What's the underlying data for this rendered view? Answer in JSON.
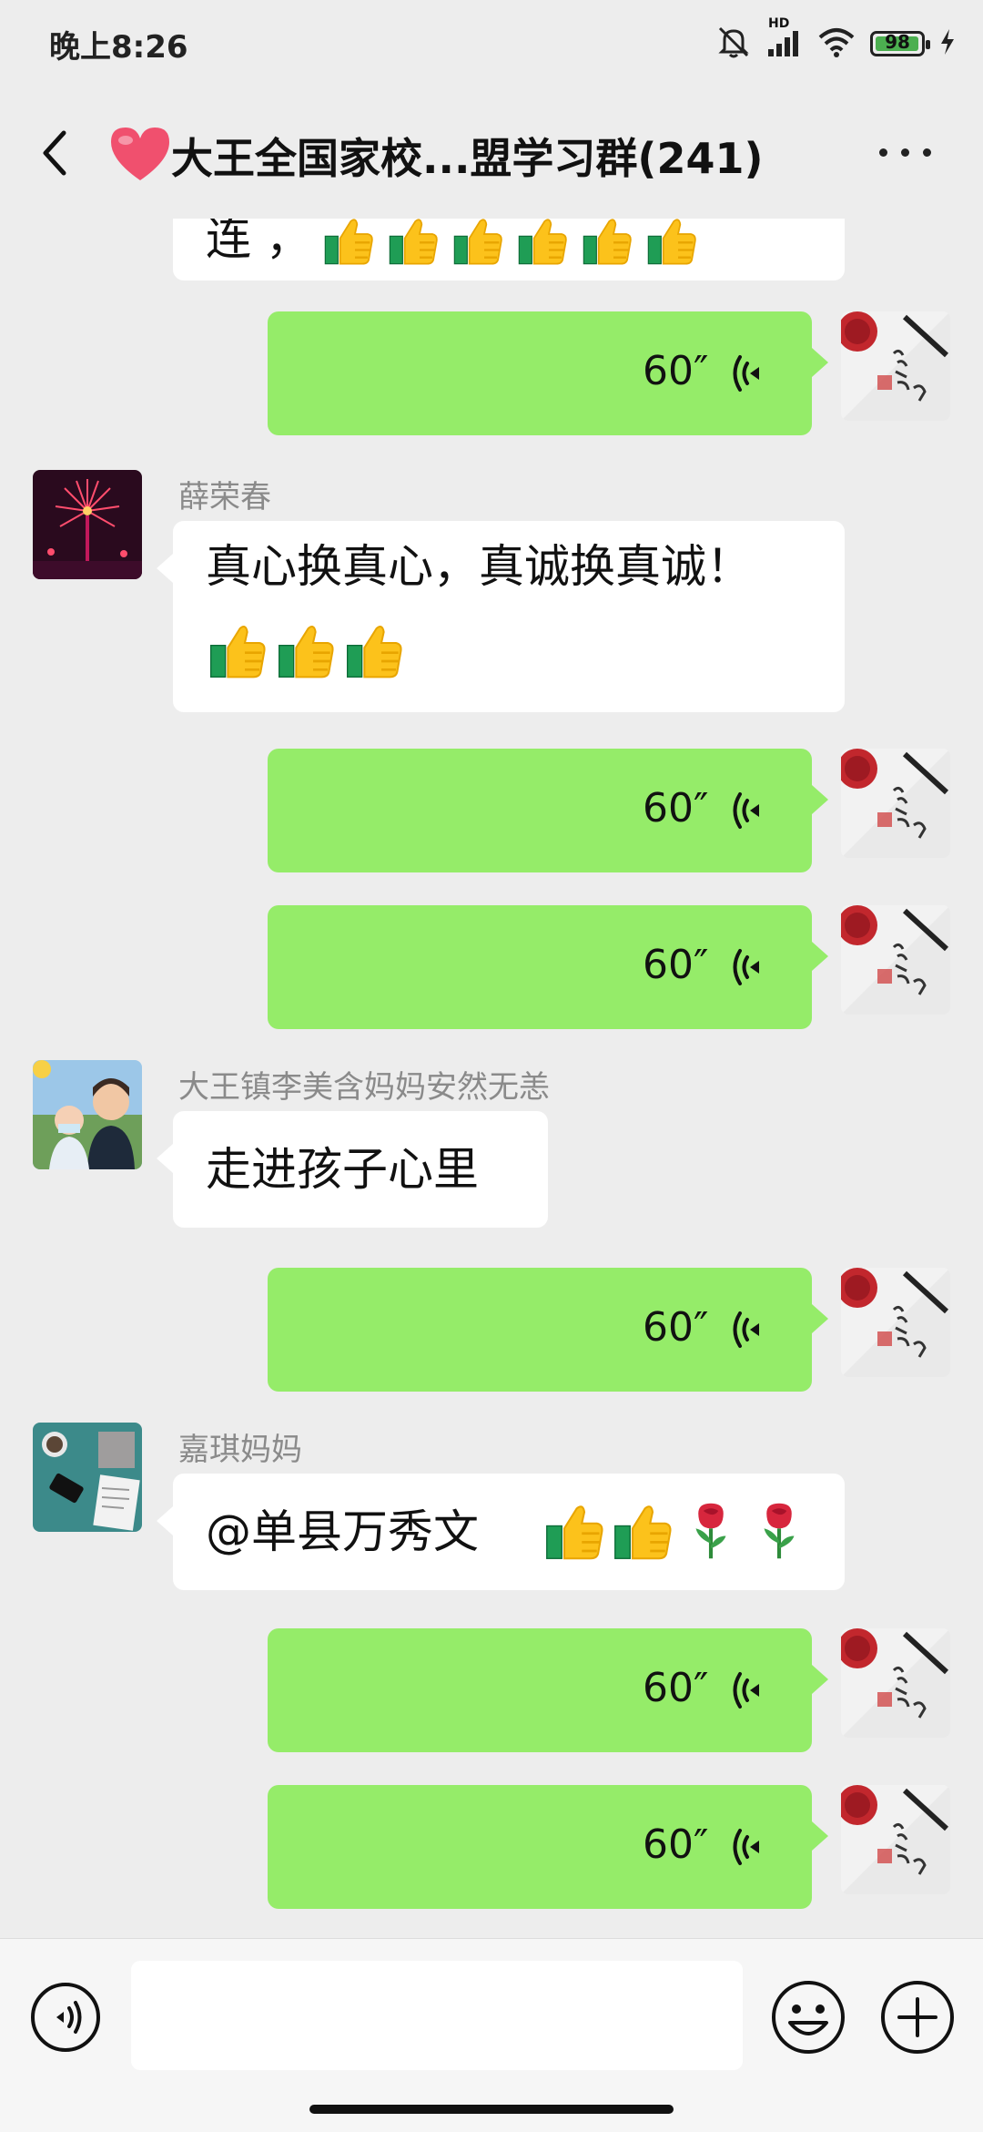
{
  "status_bar": {
    "time": "晚上8:26",
    "network_label": "HD",
    "battery": "98",
    "icons": [
      "mute-icon",
      "signal-icon",
      "wifi-icon",
      "battery-icon",
      "charging-icon"
    ]
  },
  "header": {
    "title": "大王全国家校...盟学习群(241)",
    "title_icon": "heart-icon",
    "back_icon": "back-arrow-icon",
    "more_icon": "more-icon"
  },
  "messages": [
    {
      "type": "text",
      "side": "left",
      "text": "连 ，",
      "emojis": [
        "thumbs-up",
        "thumbs-up",
        "thumbs-up",
        "thumbs-up",
        "thumbs-up",
        "thumbs-up"
      ]
    },
    {
      "type": "voice",
      "side": "right",
      "duration": "60″"
    },
    {
      "type": "text",
      "side": "left",
      "sender": "薛荣春",
      "line1": "真心换真心，真诚换真诚！",
      "emojis": [
        "thumbs-up",
        "thumbs-up",
        "thumbs-up"
      ]
    },
    {
      "type": "voice",
      "side": "right",
      "duration": "60″"
    },
    {
      "type": "voice",
      "side": "right",
      "duration": "60″"
    },
    {
      "type": "text",
      "side": "left",
      "sender": "大王镇李美含妈妈安然无恙",
      "text": "走进孩子心里"
    },
    {
      "type": "voice",
      "side": "right",
      "duration": "60″"
    },
    {
      "type": "text",
      "side": "left",
      "sender": "嘉琪妈妈",
      "text": "@单县万秀文",
      "emojis": [
        "thumbs-up",
        "thumbs-up",
        "rose",
        "rose"
      ]
    },
    {
      "type": "voice",
      "side": "right",
      "duration": "60″"
    },
    {
      "type": "voice",
      "side": "right",
      "duration": "60″"
    }
  ],
  "input_bar": {
    "message_value": "",
    "icons": [
      "voice-input-icon",
      "emoji-icon",
      "plus-icon"
    ]
  },
  "colors": {
    "background": "#ededed",
    "self_bubble": "#95ec69",
    "other_bubble": "#ffffff",
    "sender_name": "#8a8a8a"
  }
}
